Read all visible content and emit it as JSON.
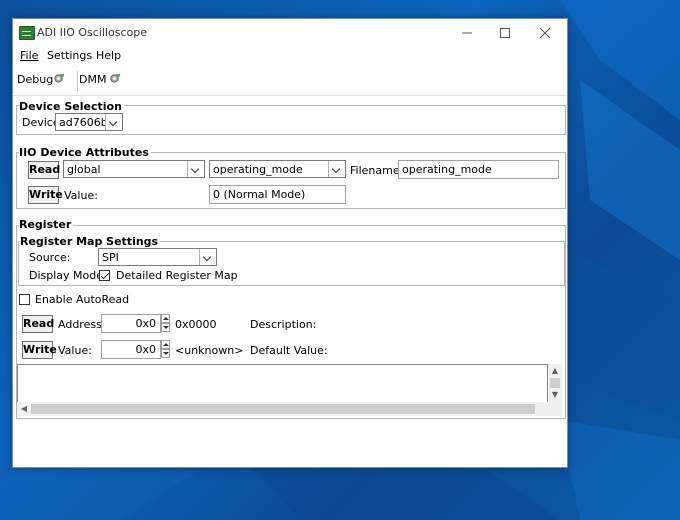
{
  "window": {
    "title": "ADI IIO Oscilloscope"
  },
  "menu": {
    "file": "File",
    "settings": "Settings",
    "help": "Help"
  },
  "toolbar": {
    "debug": "Debug",
    "dmm": "DMM"
  },
  "device_selection": {
    "title": "Device Selection",
    "device_label": "Device",
    "device_value": "ad7606b"
  },
  "iio_attributes": {
    "title": "IIO Device Attributes",
    "read_label": "Read",
    "write_label": "Write",
    "channel_value": "global",
    "attribute_value": "operating_mode",
    "filename_label": "Filename:",
    "filename_value": "operating_mode",
    "value_label": "Value:",
    "value_value": "0  (Normal Mode)"
  },
  "register": {
    "title": "Register",
    "map_settings_title": "Register Map Settings",
    "source_label": "Source:",
    "source_value": "SPI",
    "display_mode_label": "Display Mode:",
    "detailed_map_label": "Detailed Register Map",
    "auto_read_label": "Enable AutoRead",
    "read_label": "Read",
    "write_label": "Write",
    "address_label": "Address:",
    "address_value": "0x0",
    "address_hex": "0x0000",
    "description_label": "Description:",
    "value_label": "Value:",
    "value_value": "0x0",
    "value_text": "<unknown>",
    "default_value_label": "Default Value:"
  }
}
